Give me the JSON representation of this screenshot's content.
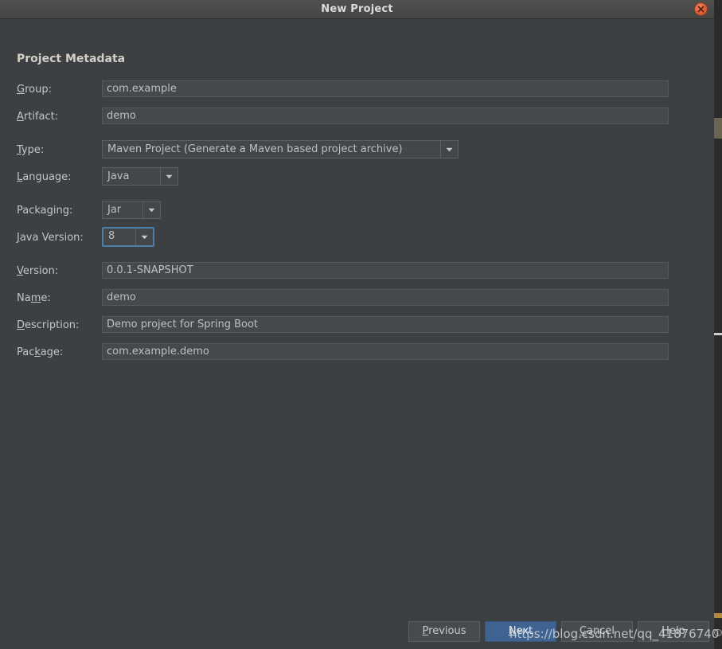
{
  "window": {
    "title": "New Project",
    "close_icon": "close-icon"
  },
  "section": {
    "heading": "Project Metadata"
  },
  "fields": {
    "group": {
      "label_pre": "",
      "label_mnemonic": "G",
      "label_post": "roup:",
      "value": "com.example"
    },
    "artifact": {
      "label_pre": "",
      "label_mnemonic": "A",
      "label_post": "rtifact:",
      "value": "demo"
    },
    "type": {
      "label_pre": "",
      "label_mnemonic": "T",
      "label_post": "ype:",
      "value": "Maven Project (Generate a Maven based project archive)"
    },
    "language": {
      "label_pre": "",
      "label_mnemonic": "L",
      "label_post": "anguage:",
      "value": "Java"
    },
    "packaging": {
      "label_pre": "Packa",
      "label_mnemonic": "g",
      "label_post": "ing:",
      "value": "Jar"
    },
    "java_version": {
      "label_pre": "",
      "label_mnemonic": "J",
      "label_post": "ava Version:",
      "value": "8"
    },
    "version": {
      "label_pre": "",
      "label_mnemonic": "V",
      "label_post": "ersion:",
      "value": "0.0.1-SNAPSHOT"
    },
    "name": {
      "label_pre": "Na",
      "label_mnemonic": "m",
      "label_post": "e:",
      "value": "demo"
    },
    "description": {
      "label_pre": "",
      "label_mnemonic": "D",
      "label_post": "escription:",
      "value": "Demo project for Spring Boot"
    },
    "package": {
      "label_pre": "Pac",
      "label_mnemonic": "k",
      "label_post": "age:",
      "value": "com.example.demo"
    }
  },
  "buttons": {
    "previous": {
      "pre": "",
      "mnemonic": "P",
      "post": "revious"
    },
    "next": {
      "pre": "",
      "mnemonic": "N",
      "post": "ext"
    },
    "cancel": {
      "pre": "",
      "mnemonic": "C",
      "post": "ancel"
    },
    "help": {
      "pre": "",
      "mnemonic": "H",
      "post": "elp"
    }
  },
  "watermark": {
    "text": "https://blog.csdn.net/qq_41876740"
  },
  "colors": {
    "dialog_background": "#3c4043",
    "titlebar": "#4a4a48",
    "field_background": "#45494c",
    "field_border": "#55595c",
    "focus_ring": "#4d7ea8",
    "primary_button": "#3f6491",
    "close_button": "#dd6238",
    "text": "#c5c5c5",
    "heading_text": "#d4cfc6"
  }
}
